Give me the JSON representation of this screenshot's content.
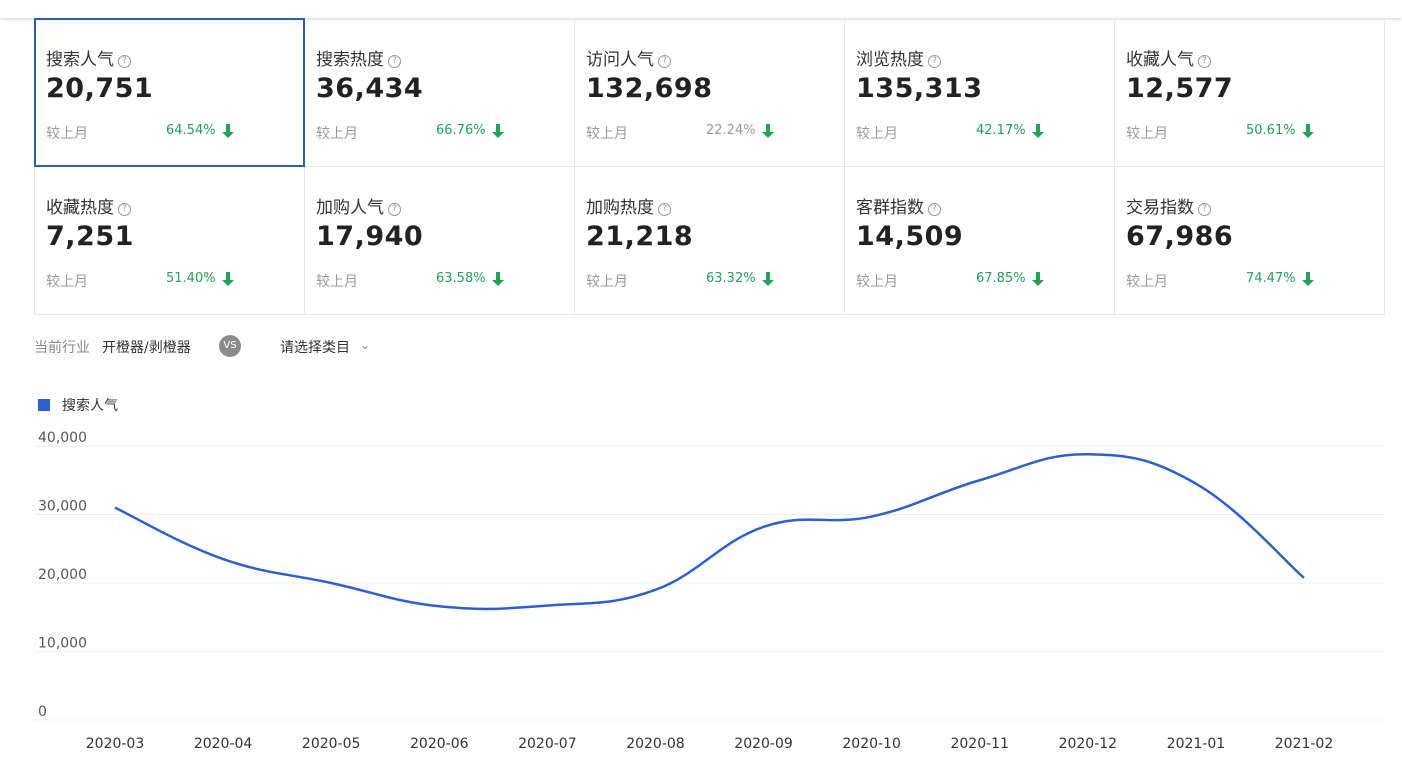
{
  "cards": [
    {
      "label": "搜索人气",
      "value": "20,751",
      "compare": "较上月",
      "pct": "64.54%",
      "trend": "down",
      "active": true
    },
    {
      "label": "搜索热度",
      "value": "36,434",
      "compare": "较上月",
      "pct": "66.76%",
      "trend": "down"
    },
    {
      "label": "访问人气",
      "value": "132,698",
      "compare": "较上月",
      "pct": "22.24%",
      "trend": "down",
      "muted": true
    },
    {
      "label": "浏览热度",
      "value": "135,313",
      "compare": "较上月",
      "pct": "42.17%",
      "trend": "down"
    },
    {
      "label": "收藏人气",
      "value": "12,577",
      "compare": "较上月",
      "pct": "50.61%",
      "trend": "down"
    },
    {
      "label": "收藏热度",
      "value": "7,251",
      "compare": "较上月",
      "pct": "51.40%",
      "trend": "down"
    },
    {
      "label": "加购人气",
      "value": "17,940",
      "compare": "较上月",
      "pct": "63.58%",
      "trend": "down"
    },
    {
      "label": "加购热度",
      "value": "21,218",
      "compare": "较上月",
      "pct": "63.32%",
      "trend": "down"
    },
    {
      "label": "客群指数",
      "value": "14,509",
      "compare": "较上月",
      "pct": "67.85%",
      "trend": "down"
    },
    {
      "label": "交易指数",
      "value": "67,986",
      "compare": "较上月",
      "pct": "74.47%",
      "trend": "down"
    }
  ],
  "filter": {
    "label": "当前行业",
    "industry": "开橙器/剥橙器",
    "vs": "VS",
    "select_placeholder": "请选择类目"
  },
  "colors": {
    "accent": "#2d5fcf",
    "down": "#22a159",
    "active_border": "#2f5ea8"
  },
  "chart_data": {
    "type": "line",
    "series": [
      {
        "name": "搜索人气",
        "values": [
          31000,
          23500,
          20000,
          16600,
          16700,
          19000,
          28200,
          29700,
          35000,
          38800,
          34500,
          20751
        ]
      }
    ],
    "categories": [
      "2020-03",
      "2020-04",
      "2020-05",
      "2020-06",
      "2020-07",
      "2020-08",
      "2020-09",
      "2020-10",
      "2020-11",
      "2020-12",
      "2021-01",
      "2021-02"
    ],
    "yticks": [
      "0",
      "10,000",
      "20,000",
      "30,000",
      "40,000"
    ],
    "ylim": [
      0,
      40000
    ],
    "grid": true,
    "legend": "top-left"
  }
}
